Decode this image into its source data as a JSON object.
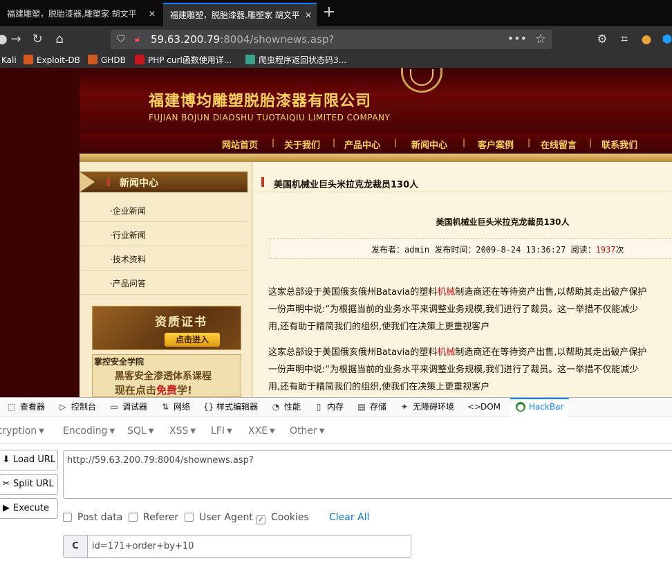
{
  "browser": {
    "tabs": [
      {
        "title": "福建雕塑，脱胎漆器,雕塑家 胡文平"
      },
      {
        "title": "福建雕塑，脱胎漆器,雕塑家 胡文平"
      }
    ],
    "url_host": "59.63.200.79",
    "url_rest": ":8004/shownews.asp?",
    "bookmarks": [
      "Kali",
      "Exploit-DB",
      "GHDB",
      "PHP curl函数使用详...",
      "爬虫程序返回状态码3..."
    ]
  },
  "site": {
    "company_cn": "福建博均雕塑脱胎漆器有限公司",
    "company_en": "FUJIAN BOJUN DIAOSHU  TUOTAIQIU  LIMITED COMPANY",
    "menu": [
      "网站首页",
      "关于我们",
      "产品中心",
      "新闻中心",
      "客户案例",
      "在线留言",
      "联系我们"
    ],
    "sidebar_title": "新闻中心",
    "sidebar_items": [
      "·企业新闻",
      "·行业新闻",
      "·技术资料",
      "·产品问答"
    ],
    "cert_title": "资质证书",
    "cert_button": "点击进入",
    "ad_line1": "掌控安全学院",
    "ad_line2": "黑客安全渗透体系课程",
    "ad_line3_pre": "现在点击",
    "ad_line3_em": "免费",
    "ad_line3_post": "学!",
    "main_head": "美国机械业巨头米拉克龙裁员130人",
    "article_title": "美国机械业巨头米拉克龙裁员130人",
    "meta_pre": "发布者：admin 发布时间：2009-8-24 13:36:27 阅读：",
    "meta_count": "1937",
    "meta_post": "次",
    "para_a_pre": "这家总部设于美国俄亥俄州Batavia的塑料",
    "para_a_hl": "机械",
    "para_a_post": "制造商还在等待资产出售,以帮助其走出破产保护",
    "para_b": "一份声明中说:“为根据当前的业务水平来调整业务规模,我们进行了裁员。这一举措不仅能减少",
    "para_c": "用,还有助于精简我们的组织,使我们在决策上更重视客户"
  },
  "devtools": {
    "tabs": [
      "查看器",
      "控制台",
      "调试器",
      "网络",
      "样式编辑器",
      "性能",
      "内存",
      "存储",
      "无障碍环境",
      "DOM",
      "HackBar"
    ]
  },
  "hackbar": {
    "menus": [
      "Encryption",
      "Encoding",
      "SQL",
      "XSS",
      "LFI",
      "XXE",
      "Other"
    ],
    "buttons": [
      "Load URL",
      "Split URL",
      "Execute"
    ],
    "url_value": "http://59.63.200.79:8004/shownews.asp?",
    "checks": [
      {
        "label": "Post data",
        "checked": false
      },
      {
        "label": "Referer",
        "checked": false
      },
      {
        "label": "User Agent",
        "checked": false
      },
      {
        "label": "Cookies",
        "checked": true
      }
    ],
    "clear_all": "Clear All",
    "cookie_label": "C",
    "cookie_value": "id=171+order+by+10"
  }
}
